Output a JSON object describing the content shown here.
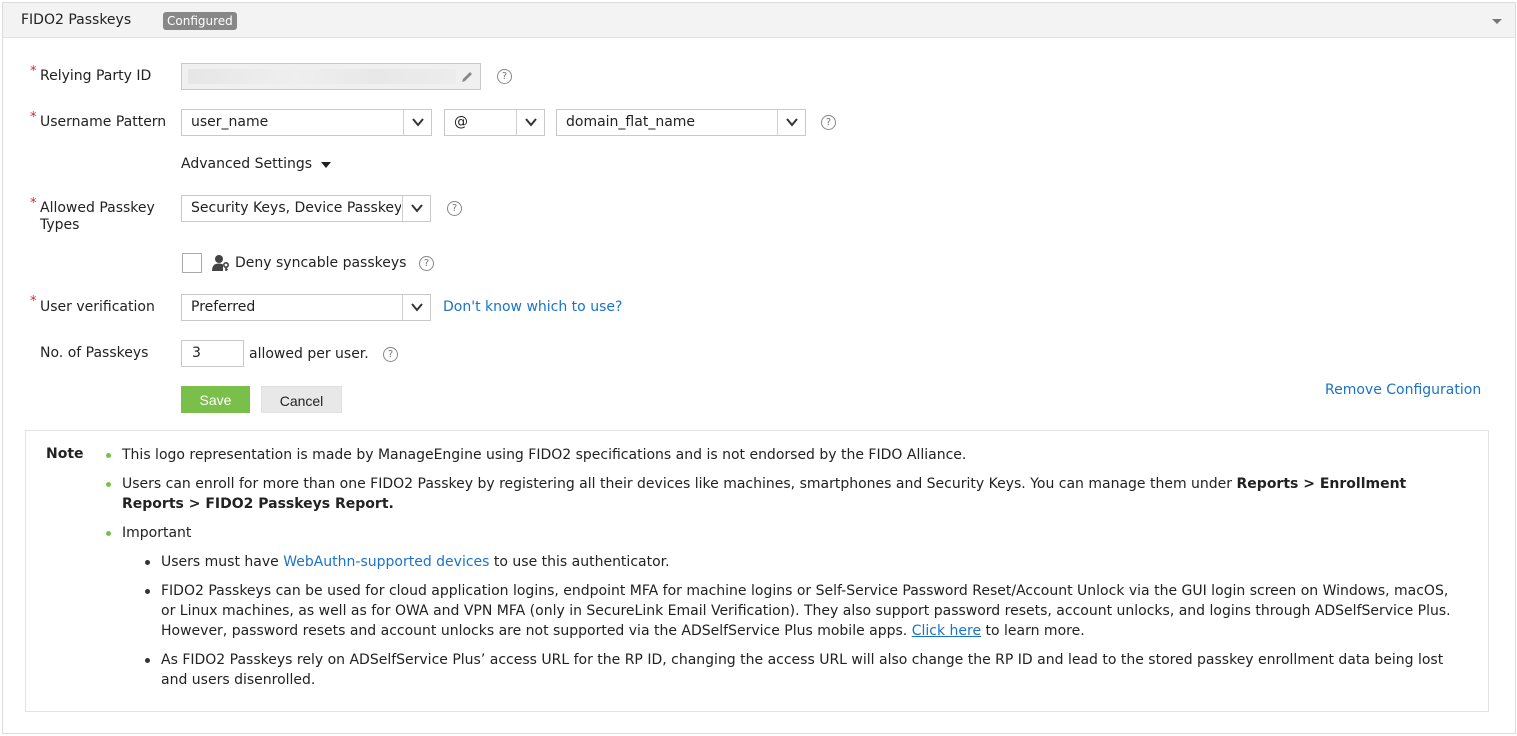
{
  "panel": {
    "title": "FIDO2 Passkeys",
    "badge": "Configured"
  },
  "form": {
    "relying_party_id": {
      "label": "Relying Party ID",
      "value": ""
    },
    "username_pattern": {
      "label": "Username Pattern",
      "part1": "user_name",
      "separator": "@",
      "part2": "domain_flat_name"
    },
    "advanced_settings_label": "Advanced Settings",
    "allowed_types": {
      "label": "Allowed Passkey Types",
      "value": "Security Keys, Device Passkeys"
    },
    "deny_syncable": {
      "label": "Deny syncable passkeys",
      "checked": false
    },
    "user_verification": {
      "label": "User verification",
      "value": "Preferred",
      "help_link": "Don't know which to use?"
    },
    "num_passkeys": {
      "label": "No. of Passkeys",
      "value": "3",
      "suffix": "allowed per user."
    },
    "save_label": "Save",
    "cancel_label": "Cancel",
    "remove_label": "Remove Configuration"
  },
  "note": {
    "title": "Note",
    "item1": "This logo representation is made by ManageEngine using FIDO2 specifications and is not endorsed by the FIDO Alliance.",
    "item2_text": "Users can enroll for more than one FIDO2 Passkey by registering all their devices like machines, smartphones and Security Keys. You can manage them under ",
    "item2_bold": "Reports > Enrollment Reports > FIDO2 Passkeys Report.",
    "item3": "Important",
    "sub1_pre": "Users must have ",
    "sub1_link": "WebAuthn-supported devices",
    "sub1_post": " to use this authenticator.",
    "sub2_pre": "FIDO2 Passkeys can be used for cloud application logins, endpoint MFA for machine logins or Self-Service Password Reset/Account Unlock via the GUI login screen on Windows, macOS, or Linux machines, as well as for OWA and VPN MFA (only in SecureLink Email Verification). They also support password resets, account unlocks, and logins through ADSelfService Plus. However, password resets and account unlocks are not supported via the ADSelfService Plus mobile apps. ",
    "sub2_link": "Click here",
    "sub2_post": " to learn more.",
    "sub3": "As FIDO2 Passkeys rely on ADSelfService Plus’ access URL for the RP ID, changing the access URL will also change the RP ID and lead to the stored passkey enrollment data being lost and users disenrolled."
  },
  "icons": {
    "help": "?",
    "required_mark": "*"
  },
  "colors": {
    "accent_green": "#79bf4a",
    "link_blue": "#1a73c8",
    "required_red": "#d9232d"
  }
}
